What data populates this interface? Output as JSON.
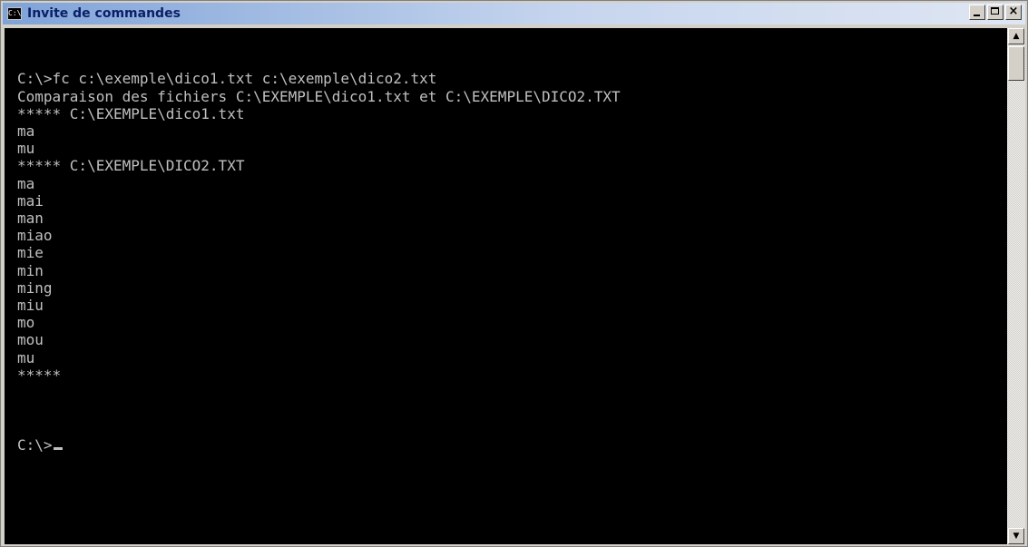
{
  "window": {
    "title": "Invite de commandes",
    "icon_label": "C:\\",
    "close_glyph": "×",
    "scroll_up_glyph": "▲",
    "scroll_down_glyph": "▼"
  },
  "console": {
    "lines": [
      "",
      "",
      "C:\\>fc c:\\exemple\\dico1.txt c:\\exemple\\dico2.txt",
      "Comparaison des fichiers C:\\EXEMPLE\\dico1.txt et C:\\EXEMPLE\\DICO2.TXT",
      "***** C:\\EXEMPLE\\dico1.txt",
      "ma",
      "mu",
      "***** C:\\EXEMPLE\\DICO2.TXT",
      "ma",
      "mai",
      "man",
      "miao",
      "mie",
      "min",
      "ming",
      "miu",
      "mo",
      "mou",
      "mu",
      "*****",
      "",
      "",
      ""
    ],
    "prompt": "C:\\>"
  },
  "colors": {
    "console_background": "#000000",
    "console_text": "#c0c0c0",
    "titlebar_text": "#0a1f66"
  }
}
